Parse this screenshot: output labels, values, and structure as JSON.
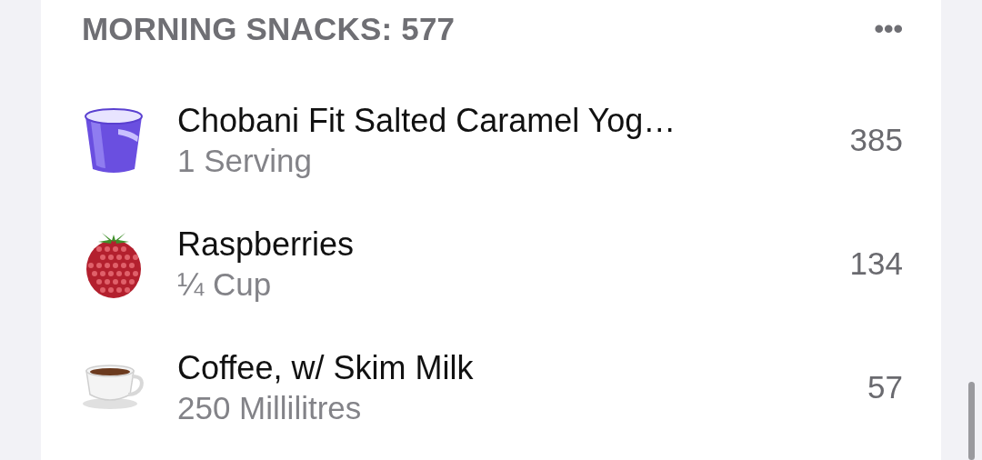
{
  "section": {
    "title": "MORNING SNACKS: 577",
    "menu": "•••"
  },
  "items": [
    {
      "kind": "yogurt",
      "name": "Chobani Fit Salted Caramel Yog…",
      "serving": "1 Serving",
      "calories": "385"
    },
    {
      "kind": "raspberry",
      "name": "Raspberries",
      "serving": "¼ Cup",
      "calories": "134"
    },
    {
      "kind": "coffee",
      "name": "Coffee, w/ Skim Milk",
      "serving": "250 Millilitres",
      "calories": "57"
    }
  ]
}
